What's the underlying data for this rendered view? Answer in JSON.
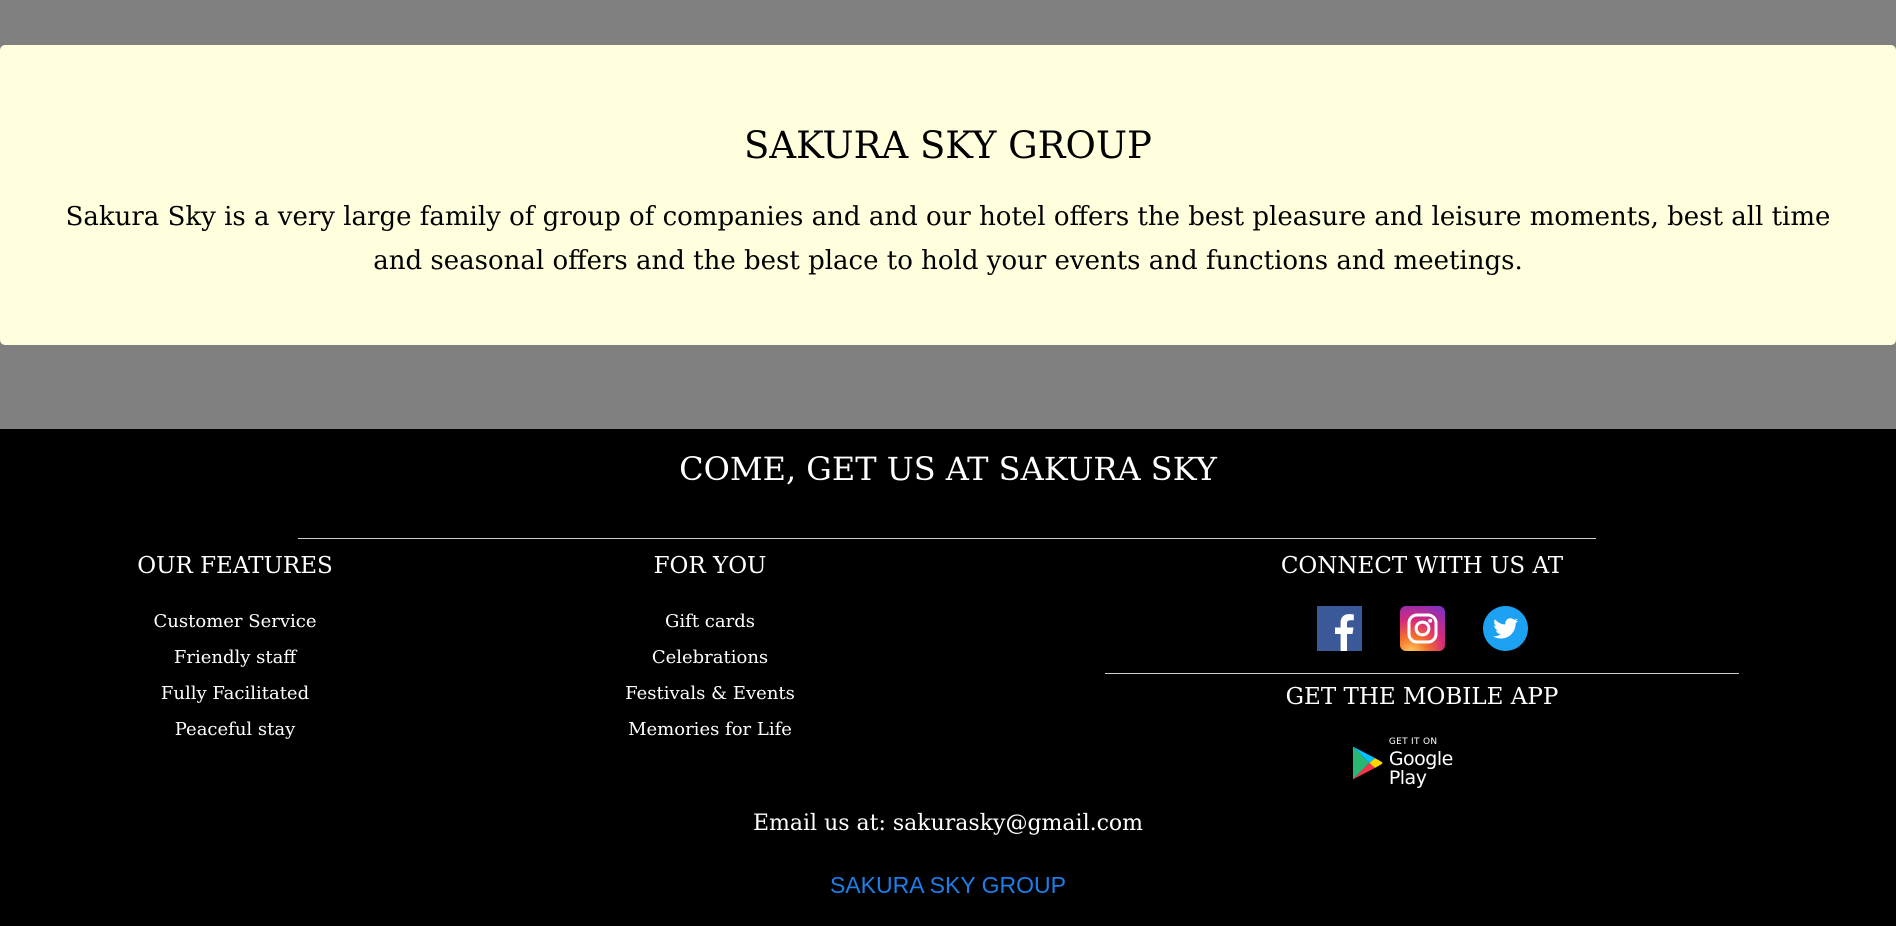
{
  "about": {
    "title": "SAKURA SKY GROUP",
    "description": "Sakura Sky is a very large family of group of companies and and our hotel offers the best pleasure and leisure moments, best all time and seasonal offers and the best place to hold your events and functions and meetings."
  },
  "footer": {
    "cta": "COME, GET US AT SAKURA SKY",
    "features": {
      "heading": "OUR FEATURES",
      "items": [
        "Customer Service",
        "Friendly staff",
        "Fully Facilitated",
        "Peaceful stay"
      ]
    },
    "for_you": {
      "heading": "FOR YOU",
      "items": [
        "Gift cards",
        "Celebrations",
        "Festivals & Events",
        "Memories for Life"
      ]
    },
    "connect": {
      "heading": "CONNECT WITH US AT",
      "social_icons": [
        "facebook-icon",
        "instagram-icon",
        "twitter-icon"
      ]
    },
    "mobile_app": {
      "heading": "GET THE MOBILE APP",
      "badge_small": "GET IT ON",
      "badge_big": "Google Play"
    },
    "email": "Email us at: sakurasky@gmail.com",
    "brand_link": "SAKURA SKY GROUP"
  },
  "colors": {
    "page_bg": "#808080",
    "card_bg": "#ffffdd",
    "footer_bg": "#000000",
    "link": "#1e7ee8",
    "facebook": "#3b5998",
    "twitter": "#1da1f2"
  }
}
